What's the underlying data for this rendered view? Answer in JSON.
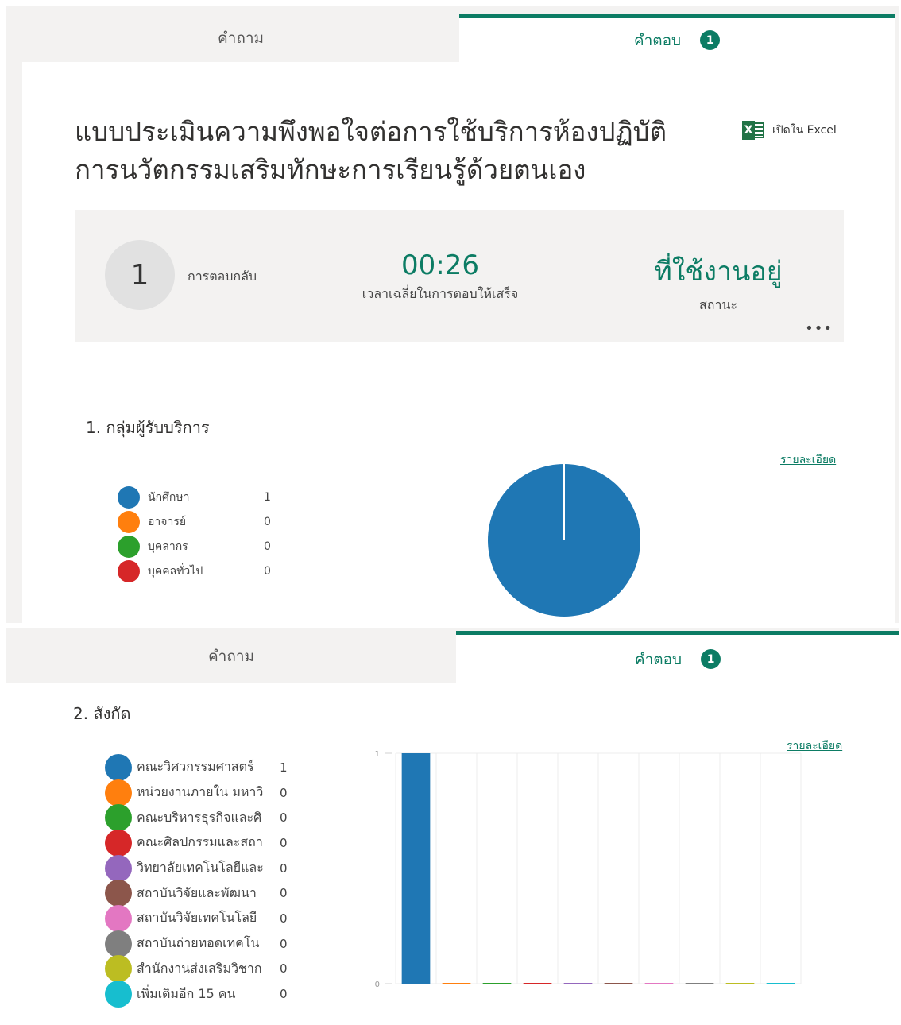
{
  "tabs": {
    "questions_label": "คำถาม",
    "responses_label": "คำตอบ",
    "responses_badge": "1"
  },
  "form": {
    "title": "แบบประเมินความพึงพอใจต่อการใช้บริการห้องปฏิบัติการนวัตกรรมเสริมทักษะการเรียนรู้ด้วยตนเอง",
    "open_in_excel": "เปิดใน Excel"
  },
  "summary": {
    "responses_count": "1",
    "responses_label": "การตอบกลับ",
    "avg_time_value": "00:26",
    "avg_time_label": "เวลาเฉลี่ยในการตอบให้เสร็จ",
    "status_value": "ที่ใช้งานอยู่",
    "status_label": "สถานะ",
    "more_label": "•••"
  },
  "questions": [
    {
      "title": "1. กลุ่มผู้รับบริการ",
      "details_link": "รายละเอียด"
    },
    {
      "title": "2. สังกัด",
      "details_link": "รายละเอียด"
    }
  ],
  "icons": {
    "excel": "excel-icon",
    "more": "more-options-icon"
  },
  "colors": {
    "accent": "#0c7c64",
    "tab_bg": "#f3f2f1",
    "summary_bg": "#f3f2f1"
  },
  "chart_data": [
    {
      "type": "pie",
      "categories": [
        "นักศึกษา",
        "อาจารย์",
        "บุคลากร",
        "บุคคลทั่วไป"
      ],
      "values": [
        1,
        0,
        0,
        0
      ],
      "colors": [
        "#1f77b4",
        "#ff7f0e",
        "#2ca02c",
        "#d62728"
      ]
    },
    {
      "type": "bar",
      "categories": [
        "คณะวิศวกรรมศาสตร์",
        "หน่วยงานภายใน มหาวิ",
        "คณะบริหารธุรกิจและศิ",
        "คณะศิลปกรรมและสถา",
        "วิทยาลัยเทคโนโลยีและ",
        "สถาบันวิจัยและพัฒนา",
        "สถาบันวิจัยเทคโนโลยี",
        "สถาบันถ่ายทอดเทคโน",
        "สำนักงานส่งเสริมวิชาก",
        "เพิ่มเติมอีก 15 คน"
      ],
      "values": [
        1,
        0,
        0,
        0,
        0,
        0,
        0,
        0,
        0,
        0
      ],
      "colors": [
        "#1f77b4",
        "#ff7f0e",
        "#2ca02c",
        "#d62728",
        "#9467bd",
        "#8c564b",
        "#e377c2",
        "#7f7f7f",
        "#bcbd22",
        "#17becf"
      ],
      "ylim": [
        0,
        1
      ],
      "ytick_labels": [
        "1",
        "0"
      ]
    }
  ]
}
